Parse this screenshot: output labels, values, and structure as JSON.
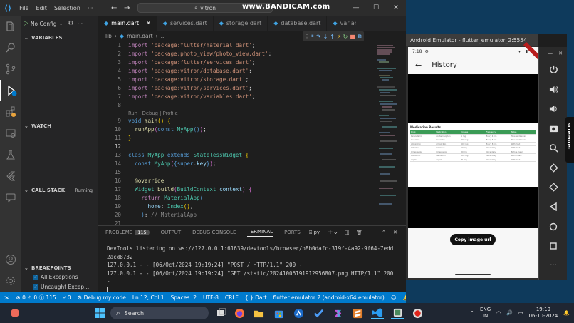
{
  "titlebar": {
    "menus": [
      "File",
      "Edit",
      "Selection",
      "···"
    ],
    "search": "vitron",
    "watermark": "www.BANDICAM.com"
  },
  "sidebar": {
    "config": "No Config",
    "sections": [
      {
        "label": "VARIABLES"
      },
      {
        "label": "WATCH"
      },
      {
        "label": "CALL STACK",
        "status": "Running"
      },
      {
        "label": "BREAKPOINTS"
      }
    ],
    "breakpoints": [
      {
        "label": "All Exceptions",
        "checked": true
      },
      {
        "label": "Uncaught Excep...",
        "checked": true
      }
    ]
  },
  "tabs": [
    {
      "label": "main.dart",
      "active": true
    },
    {
      "label": "services.dart"
    },
    {
      "label": "storage.dart"
    },
    {
      "label": "database.dart"
    },
    {
      "label": "variał"
    }
  ],
  "breadcrumb": [
    "lib",
    "main.dart",
    "..."
  ],
  "editor": {
    "lines": [
      "1",
      "2",
      "3",
      "4",
      "5",
      "6",
      "7",
      "8",
      "9",
      "10",
      "11",
      "12",
      "13",
      "14",
      "15",
      "16",
      "17",
      "18",
      "19",
      "20",
      "21"
    ],
    "codelens": "Run | Debug | Profile",
    "imports": [
      "'package:flutter/material.dart'",
      "'package:photo_view/photo_view.dart'",
      "'package:flutter/services.dart'",
      "'package:vitron/database.dart'",
      "'package:vitron/storage.dart'",
      "'package:vitron/services.dart'",
      "'package:vitron/variables.dart'"
    ]
  },
  "panel": {
    "tabs": [
      "PROBLEMS",
      "OUTPUT",
      "DEBUG CONSOLE",
      "TERMINAL",
      "PORTS"
    ],
    "problems_count": "115",
    "shell": "py",
    "terminal": [
      "DevTools listening on ws://127.0.0.1:61639/devtools/browser/b8b0dafc-319f-4a92-9f64-7edd",
      "2acd8732",
      "127.0.0.1 - - [06/Oct/2024 19:19:24] \"POST / HTTP/1.1\" 200 -",
      "127.0.0.1 - - [06/Oct/2024 19:19:24] \"GET /static/20241006191912956807.png HTTP/1.1\" 200",
      " -"
    ]
  },
  "statusbar": {
    "problems": "⊗ 0 ⚠ 0 ⓘ 115",
    "ports": "0",
    "debug": "Debug my code",
    "position": "Ln 12, Col 1",
    "spaces": "Spaces: 2",
    "encoding": "UTF-8",
    "eol": "CRLF",
    "language": "{ } Dart",
    "device": "flutter emulator 2 (android-x64 emulator)"
  },
  "emulator": {
    "title": "Android Emulator - flutter_emulator_2:5554",
    "time": "7:18",
    "app_title": "History",
    "image_heading": "Medication Results",
    "image_rows": [
      [
        "Drug",
        "Medication",
        "Dosage",
        "Frequency",
        "Notes"
      ],
      [
        "Paracetamol",
        "Acetaminophen",
        "1 mg",
        "Every 4 hrs",
        "Take as directed"
      ],
      [
        "Ibuprofen",
        "Ibuprofen",
        "200 mg",
        "Every 6 hrs",
        "Take as directed"
      ],
      [
        "Amoxicillin",
        "Amoxicillin",
        "500 mg",
        "Every 8 hrs",
        "With food"
      ],
      [
        "Cetirizine",
        "Cetirizine",
        "10 mg",
        "Once daily",
        "With food"
      ],
      [
        "Omeprazole",
        "Omeprazole",
        "20 mg",
        "Once daily",
        "Before meal"
      ],
      [
        "Metformin",
        "Metformin",
        "500 mg",
        "Twice daily",
        "With meals"
      ],
      [
        "Aspirin",
        "Aspirin",
        "81 mg",
        "Once daily",
        "With food"
      ]
    ],
    "copy_button": "Copy image url"
  },
  "taskbar": {
    "search": "Search",
    "lang": "ENG",
    "region": "IN",
    "time": "19:19",
    "date": "06-10-2024"
  }
}
